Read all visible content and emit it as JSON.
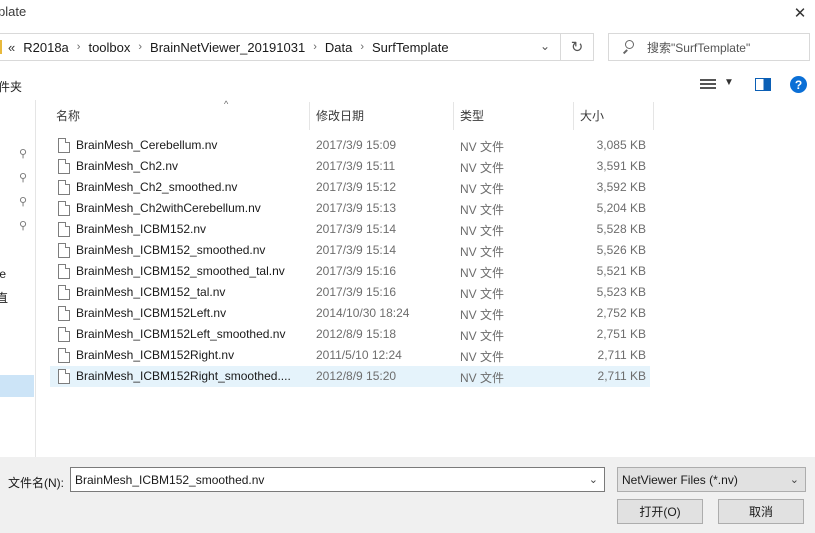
{
  "window": {
    "title_fragment": "plate",
    "close_glyph": "✕"
  },
  "address": {
    "overflow": "«",
    "crumbs": [
      "R2018a",
      "toolbox",
      "BrainNetViewer_20191031",
      "Data",
      "SurfTemplate"
    ],
    "separator": "›",
    "dropdown_glyph": "⌄",
    "refresh_glyph": "↻"
  },
  "search": {
    "placeholder": "搜索\"SurfTemplate\""
  },
  "toolbar": {
    "new_folder_fragment": "件夹",
    "view_dropdown_glyph": "▼",
    "help_glyph": "?"
  },
  "nav": {
    "fragments": [
      "te",
      "直"
    ],
    "pin_glyph": "📌"
  },
  "columns": {
    "name": "名称",
    "date": "修改日期",
    "type": "类型",
    "size": "大小",
    "sort_glyph": "^"
  },
  "files": [
    {
      "name": "BrainMesh_Cerebellum.nv",
      "date": "2017/3/9 15:09",
      "type": "NV 文件",
      "size": "3,085 KB"
    },
    {
      "name": "BrainMesh_Ch2.nv",
      "date": "2017/3/9 15:11",
      "type": "NV 文件",
      "size": "3,591 KB"
    },
    {
      "name": "BrainMesh_Ch2_smoothed.nv",
      "date": "2017/3/9 15:12",
      "type": "NV 文件",
      "size": "3,592 KB"
    },
    {
      "name": "BrainMesh_Ch2withCerebellum.nv",
      "date": "2017/3/9 15:13",
      "type": "NV 文件",
      "size": "5,204 KB"
    },
    {
      "name": "BrainMesh_ICBM152.nv",
      "date": "2017/3/9 15:14",
      "type": "NV 文件",
      "size": "5,528 KB"
    },
    {
      "name": "BrainMesh_ICBM152_smoothed.nv",
      "date": "2017/3/9 15:14",
      "type": "NV 文件",
      "size": "5,526 KB"
    },
    {
      "name": "BrainMesh_ICBM152_smoothed_tal.nv",
      "date": "2017/3/9 15:16",
      "type": "NV 文件",
      "size": "5,521 KB"
    },
    {
      "name": "BrainMesh_ICBM152_tal.nv",
      "date": "2017/3/9 15:16",
      "type": "NV 文件",
      "size": "5,523 KB"
    },
    {
      "name": "BrainMesh_ICBM152Left.nv",
      "date": "2014/10/30 18:24",
      "type": "NV 文件",
      "size": "2,752 KB"
    },
    {
      "name": "BrainMesh_ICBM152Left_smoothed.nv",
      "date": "2012/8/9 15:18",
      "type": "NV 文件",
      "size": "2,751 KB"
    },
    {
      "name": "BrainMesh_ICBM152Right.nv",
      "date": "2011/5/10 12:24",
      "type": "NV 文件",
      "size": "2,711 KB"
    },
    {
      "name": "BrainMesh_ICBM152Right_smoothed....",
      "date": "2012/8/9 15:20",
      "type": "NV 文件",
      "size": "2,711 KB",
      "hovered": true
    }
  ],
  "bottom": {
    "filename_label": "文件名(N):",
    "filename_value": "BrainMesh_ICBM152_smoothed.nv",
    "filter_value": "NetViewer Files (*.nv)",
    "open_label": "打开(O)",
    "cancel_label": "取消",
    "dropdown_glyph": "⌄"
  },
  "colors": {
    "accent": "#0b6fd6",
    "selection": "#e5f3fb",
    "nav_selection": "#cce4f7",
    "panel": "#f0f0f0"
  }
}
